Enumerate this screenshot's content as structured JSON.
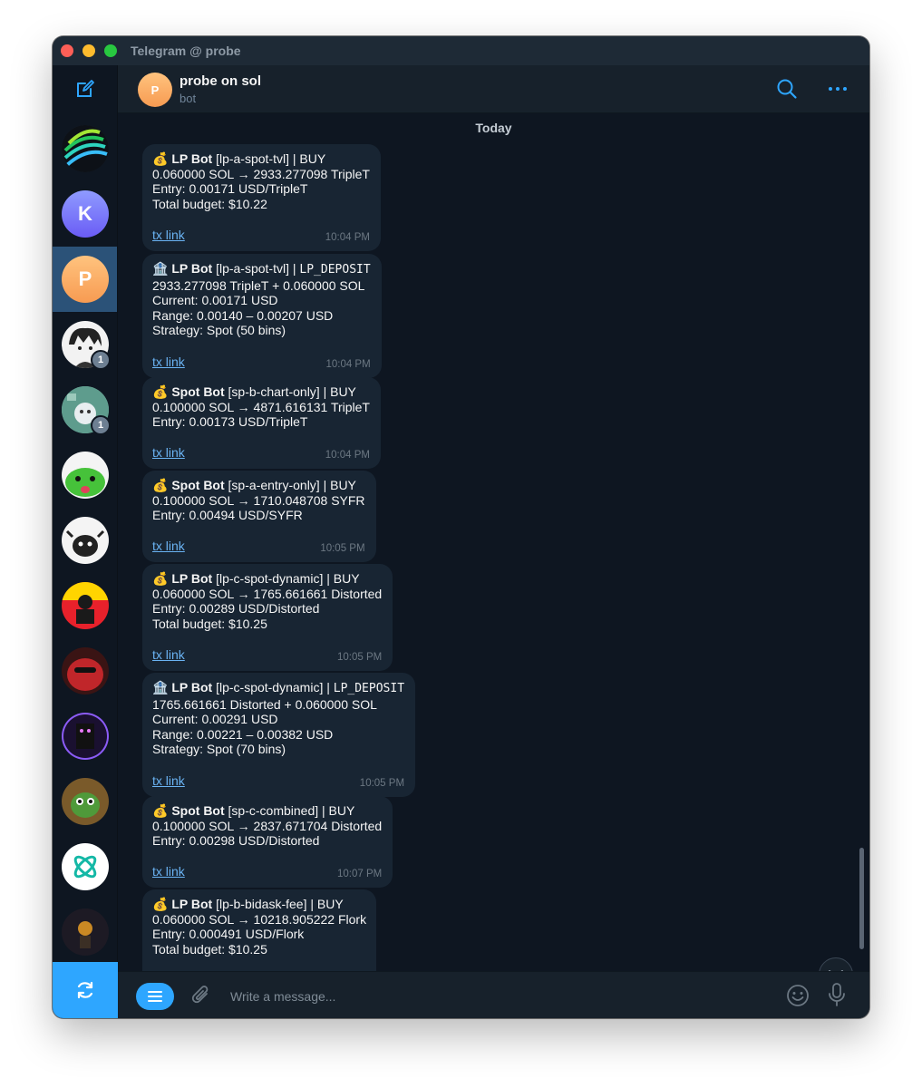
{
  "window": {
    "title": "Telegram @ probe"
  },
  "header": {
    "name": "probe on sol",
    "status": "bot",
    "avatar_letter": "P"
  },
  "sidebar": {
    "items": [
      {
        "kind": "image",
        "letter": ""
      },
      {
        "kind": "letter",
        "letter": "K"
      },
      {
        "kind": "letter",
        "letter": "P",
        "active": true
      },
      {
        "kind": "image",
        "letter": "",
        "badge": "1"
      },
      {
        "kind": "image",
        "letter": "",
        "badge": "1"
      },
      {
        "kind": "image",
        "letter": ""
      },
      {
        "kind": "image",
        "letter": ""
      },
      {
        "kind": "image",
        "letter": ""
      },
      {
        "kind": "image",
        "letter": ""
      },
      {
        "kind": "image",
        "letter": ""
      },
      {
        "kind": "image",
        "letter": ""
      },
      {
        "kind": "image",
        "letter": ""
      },
      {
        "kind": "image",
        "letter": ""
      }
    ]
  },
  "chat": {
    "date_separator": "Today",
    "messages": [
      {
        "emoji": "💰",
        "bot": "LP Bot",
        "rest": " [lp-a-spot-tvl] | BUY",
        "lines": [
          "0.060000 SOL → 2933.277098 TripleT",
          "Entry: 0.00171 USD/TripleT",
          "Total budget: $10.22"
        ],
        "link": "tx link",
        "time": "10:04 PM"
      },
      {
        "emoji": "🏦",
        "bot": "LP Bot",
        "rest": " [lp-a-spot-tvl] | ",
        "mono": "LP_DEPOSIT",
        "lines": [
          "2933.277098 TripleT + 0.060000 SOL",
          "Current: 0.00171 USD",
          "Range: 0.00140 – 0.00207 USD",
          "Strategy: Spot (50 bins)"
        ],
        "link": "tx link",
        "time": "10:04 PM"
      },
      {
        "emoji": "💰",
        "bot": "Spot Bot",
        "rest": " [sp-b-chart-only] | BUY",
        "lines": [
          "0.100000 SOL → 4871.616131 TripleT",
          "Entry: 0.00173 USD/TripleT"
        ],
        "link": "tx link",
        "time": "10:04 PM"
      },
      {
        "emoji": "💰",
        "bot": "Spot Bot",
        "rest": " [sp-a-entry-only] | BUY",
        "lines": [
          "0.100000 SOL → 1710.048708 SYFR",
          "Entry: 0.00494 USD/SYFR"
        ],
        "link": "tx link",
        "time": "10:05 PM"
      },
      {
        "emoji": "💰",
        "bot": "LP Bot",
        "rest": " [lp-c-spot-dynamic] | BUY",
        "lines": [
          "0.060000 SOL → 1765.661661 Distorted",
          "Entry: 0.00289 USD/Distorted",
          "Total budget: $10.25"
        ],
        "link": "tx link",
        "time": "10:05 PM"
      },
      {
        "emoji": "🏦",
        "bot": "LP Bot",
        "rest": " [lp-c-spot-dynamic] | ",
        "mono": "LP_DEPOSIT",
        "lines": [
          "1765.661661 Distorted + 0.060000 SOL",
          "Current: 0.00291 USD",
          "Range: 0.00221 – 0.00382 USD",
          "Strategy: Spot (70 bins)"
        ],
        "link": "tx link",
        "time": "10:05 PM"
      },
      {
        "emoji": "💰",
        "bot": "Spot Bot",
        "rest": " [sp-c-combined] | BUY",
        "lines": [
          "0.100000 SOL → 2837.671704 Distorted",
          "Entry: 0.00298 USD/Distorted"
        ],
        "link": "tx link",
        "time": "10:07 PM"
      },
      {
        "emoji": "💰",
        "bot": "LP Bot",
        "rest": " [lp-b-bidask-fee] | BUY",
        "lines": [
          "0.060000 SOL → 10218.905222 Flork",
          "Entry: 0.000491 USD/Flork",
          "Total budget: $10.25"
        ],
        "link": "",
        "time": ""
      }
    ]
  },
  "composer": {
    "placeholder": "Write a message..."
  }
}
